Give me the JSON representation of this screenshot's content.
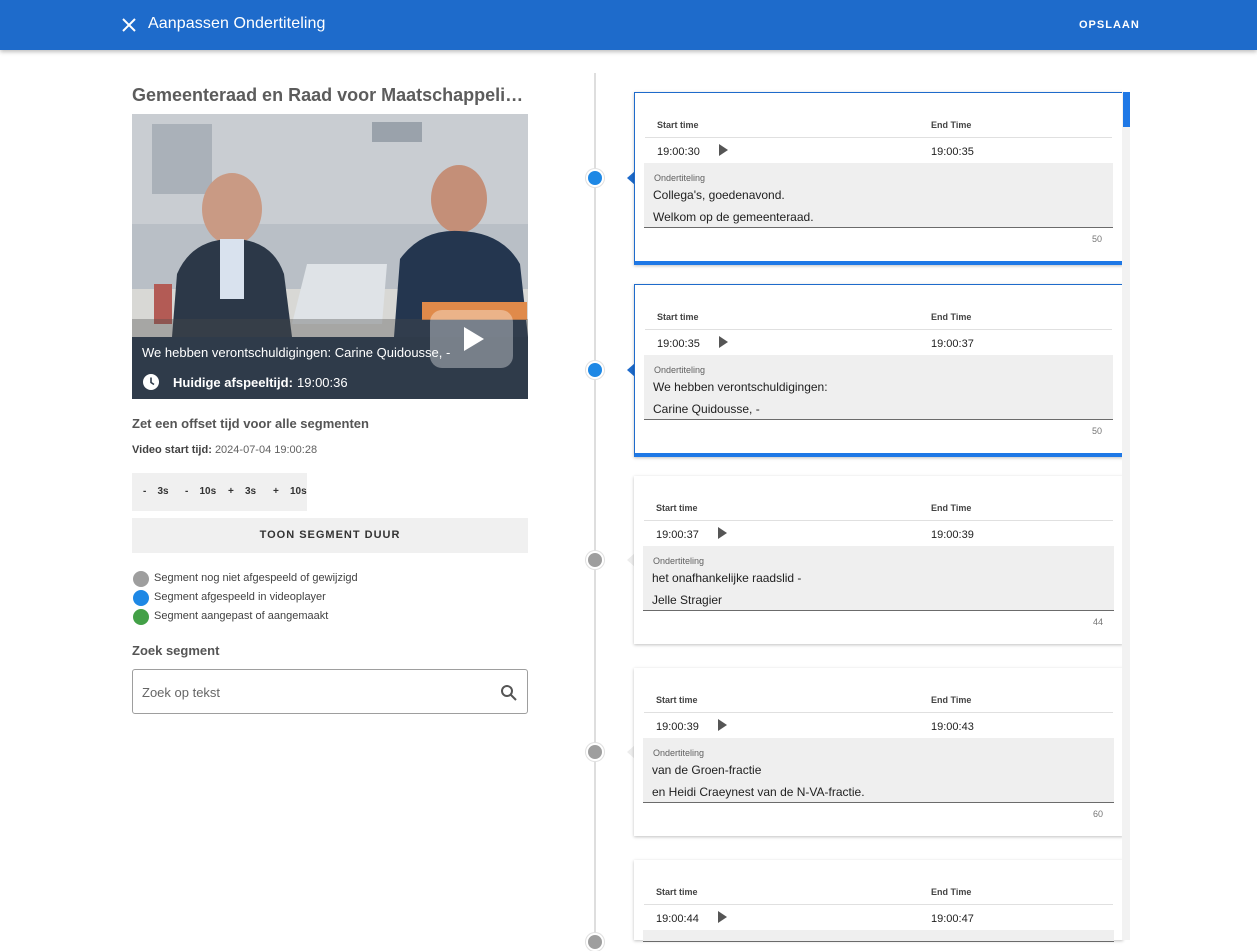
{
  "appbar": {
    "title": "Aanpassen Ondertiteling",
    "save_label": "OPSLAAN",
    "color": "#1e6bcb"
  },
  "video": {
    "title": "Gemeenteraad en Raad voor Maatschappelijk Welzijn",
    "subtitle": "We hebben verontschuldigingen: Carine Quidousse, -",
    "current_time_label": "Huidige afspeeltijd:",
    "current_time": "19:00:36"
  },
  "offset": {
    "title": "Zet een offset tijd voor alle segmenten",
    "start_label": "Video start tijd:",
    "start_value": "2024-07-04 19:00:28",
    "buttons": [
      "-    3s",
      "-    10s",
      "+    3s",
      "+    10s"
    ],
    "show_duration_label": "TOON SEGMENT DUUR"
  },
  "legend": [
    {
      "label": "Segment nog niet afgespeeld of gewijzigd",
      "color": "#9e9e9e"
    },
    {
      "label": "Segment afgespeeld in videoplayer",
      "color": "#1e88e5"
    },
    {
      "label": "Segment aangepast of aangemaakt",
      "color": "#43a047"
    }
  ],
  "search": {
    "title": "Zoek segment",
    "placeholder": "Zoek op tekst"
  },
  "segments_header": {
    "start": "Start time",
    "end": "End Time",
    "field_label": "Ondertiteling"
  },
  "segments": [
    {
      "start": "19:00:30",
      "end": "19:00:35",
      "text": "Collega's, goedenavond.\nWelkom op de gemeenteraad.",
      "count": "50",
      "state": "played"
    },
    {
      "start": "19:00:35",
      "end": "19:00:37",
      "text": "We hebben verontschuldigingen:\nCarine Quidousse, -",
      "count": "50",
      "state": "played"
    },
    {
      "start": "19:00:37",
      "end": "19:00:39",
      "text": "het onafhankelijke raadslid -\nJelle Stragier",
      "count": "44",
      "state": "not-played"
    },
    {
      "start": "19:00:39",
      "end": "19:00:43",
      "text": "van de Groen-fractie\nen Heidi Craeynest van de N-VA-fractie.",
      "count": "60",
      "state": "not-played"
    },
    {
      "start": "19:00:44",
      "end": "19:00:47",
      "text": "",
      "count": "",
      "state": "not-played"
    }
  ]
}
